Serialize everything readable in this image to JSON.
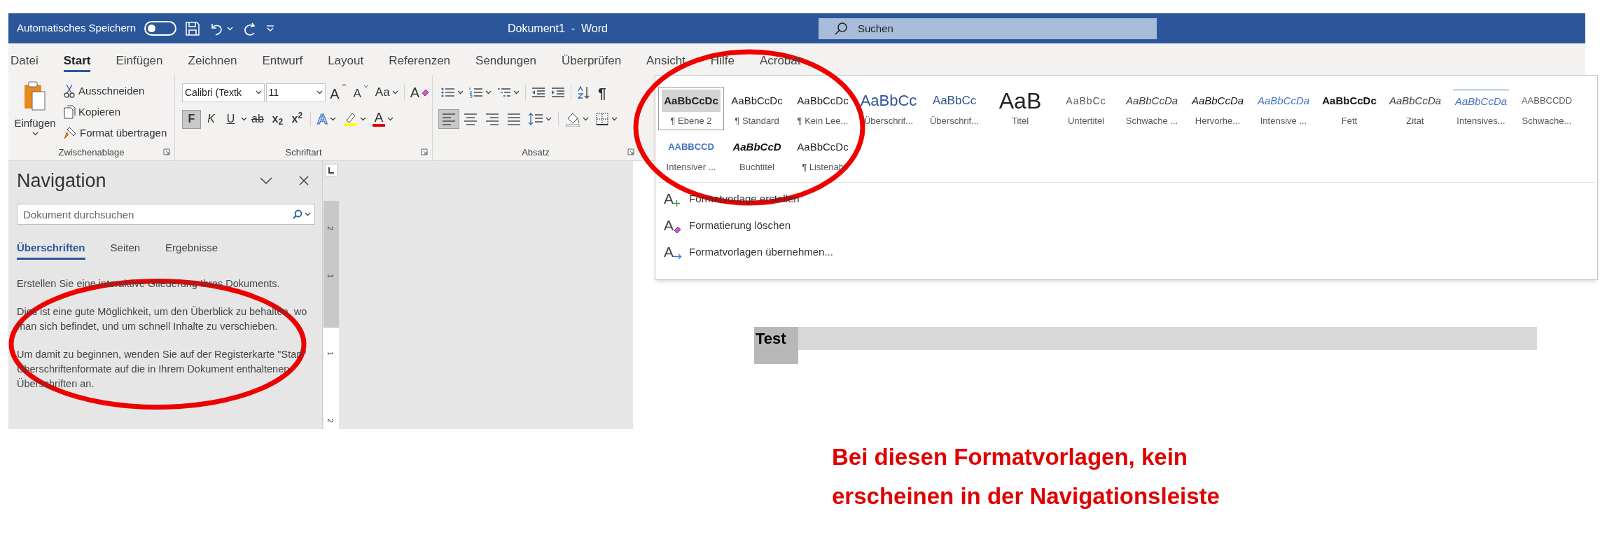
{
  "title_bar": {
    "autosave": {
      "label": "Automatisches Speichern",
      "on": false
    },
    "title": "Dokument1  -  Word",
    "search": {
      "placeholder": "Suchen"
    }
  },
  "tabs": [
    {
      "label": "Datei",
      "selected": false
    },
    {
      "label": "Start",
      "selected": true
    },
    {
      "label": "Einfügen",
      "selected": false
    },
    {
      "label": "Zeichnen",
      "selected": false
    },
    {
      "label": "Entwurf",
      "selected": false
    },
    {
      "label": "Layout",
      "selected": false
    },
    {
      "label": "Referenzen",
      "selected": false
    },
    {
      "label": "Sendungen",
      "selected": false
    },
    {
      "label": "Überprüfen",
      "selected": false
    },
    {
      "label": "Ansicht",
      "selected": false
    },
    {
      "label": "Hilfe",
      "selected": false
    },
    {
      "label": "Acrobat",
      "selected": false
    }
  ],
  "ribbon": {
    "clipboard": {
      "paste": "Einfügen",
      "items": [
        {
          "kind": "cut",
          "label": "Ausschneiden"
        },
        {
          "kind": "copy",
          "label": "Kopieren"
        },
        {
          "kind": "painter",
          "label": "Format übertragen"
        }
      ],
      "group_label": "Zwischenablage"
    },
    "font": {
      "font_name": "Calibri (Textk",
      "font_size": "11",
      "size_buttons": [
        {
          "kind": "grow",
          "label": "A"
        },
        {
          "kind": "shrink",
          "label": "A"
        },
        {
          "kind": "case",
          "label": "Aa"
        },
        {
          "kind": "clear",
          "label": "A"
        }
      ],
      "toggles": [
        {
          "kind": "bold",
          "label": "F",
          "on": true
        },
        {
          "kind": "italic",
          "label": "K",
          "on": false
        },
        {
          "kind": "underline",
          "label": "U",
          "on": false
        },
        {
          "kind": "strike",
          "label": "ab",
          "on": false
        },
        {
          "kind": "subscript",
          "label": "x$_{2}$",
          "on": false
        },
        {
          "kind": "superscript",
          "label": "x$^{2}$",
          "on": false
        }
      ],
      "color_buttons": [
        {
          "kind": "effects",
          "label": "A"
        },
        {
          "kind": "highlight"
        },
        {
          "kind": "color",
          "label": "A"
        }
      ],
      "group_label": "Schriftart"
    },
    "paragraph": {
      "alignment": [
        {
          "kind": "left",
          "selected": true
        },
        {
          "kind": "center",
          "selected": false
        },
        {
          "kind": "right",
          "selected": false
        },
        {
          "kind": "justify",
          "selected": false
        }
      ],
      "pilcrow": "¶",
      "group_label": "Absatz"
    }
  },
  "navigation": {
    "title": "Navigation",
    "search": {
      "placeholder": "Dokument durchsuchen"
    },
    "tabs": [
      {
        "label": "Überschriften",
        "selected": true
      },
      {
        "label": "Seiten",
        "selected": false
      },
      {
        "label": "Ergebnisse",
        "selected": false
      }
    ],
    "paragraphs": [
      "Erstellen Sie eine interaktive Gliederung Ihres Dokuments.",
      "Dies ist eine gute Möglichkeit, um den Überblick zu behalten, wo man sich befindet, und um schnell Inhalte zu verschieben.",
      "Um damit zu beginnen, wenden Sie auf der Registerkarte \"Start\" Überschriftenformate auf die in Ihrem Dokument enthaltenen Überschriften an."
    ]
  },
  "ruler": {
    "labels": [
      "2",
      "1",
      "1",
      "2"
    ]
  },
  "document": {
    "heading": "Test"
  },
  "styles_gallery": {
    "styles": [
      {
        "kind": "level2",
        "preview": "AaBbCcDc",
        "label": "¶ Ebene 2",
        "selected": true
      },
      {
        "kind": "normal",
        "preview": "AaBbCcDc",
        "label": "¶ Standard",
        "selected": false
      },
      {
        "kind": "normal",
        "preview": "AaBbCcDc",
        "label": "¶ Kein Lee...",
        "selected": false
      },
      {
        "kind": "heading1",
        "preview": "AaBbCc",
        "label": "Überschrif...",
        "selected": false
      },
      {
        "kind": "heading2",
        "preview": "AaBbCc",
        "label": "Überschrif...",
        "selected": false
      },
      {
        "kind": "title",
        "preview": "AaB",
        "label": "Titel",
        "selected": false
      },
      {
        "kind": "subtitle",
        "preview": "AaBbCc",
        "label": "Untertitel",
        "selected": false
      },
      {
        "kind": "subtle_emphasis",
        "preview": "AaBbCcDa",
        "label": "Schwache ...",
        "selected": false
      },
      {
        "kind": "emphasis",
        "preview": "AaBbCcDa",
        "label": "Hervorhe...",
        "selected": false
      },
      {
        "kind": "intense_emphasis",
        "preview": "AaBbCcDa",
        "label": "Intensive ...",
        "selected": false
      },
      {
        "kind": "strong",
        "preview": "AaBbCcDc",
        "label": "Fett",
        "selected": false
      },
      {
        "kind": "quote",
        "preview": "AaBbCcDa",
        "label": "Zitat",
        "selected": false
      },
      {
        "kind": "intense_quote",
        "preview": "AaBbCcDa",
        "label": "Intensives...",
        "selected": false
      },
      {
        "kind": "subtle_reference",
        "preview": "AABBCCDD",
        "label": "Schwache...",
        "selected": false
      },
      {
        "kind": "intense_reference",
        "preview": "AABBCCD",
        "label": "Intensiver ...",
        "selected": false
      },
      {
        "kind": "book_title",
        "preview": "AaBbCcD",
        "label": "Buchtitel",
        "selected": false
      },
      {
        "kind": "normal",
        "preview": "AaBbCcDc",
        "label": "¶ Listenab",
        "selected": false
      }
    ],
    "commands": [
      {
        "kind": "create",
        "glyph": "A",
        "label": "Formatvorlage erstellen"
      },
      {
        "kind": "clear",
        "glyph": "A",
        "label": "Formatierung löschen"
      },
      {
        "kind": "apply",
        "glyph": "A",
        "label": "Formatvorlagen übernehmen..."
      }
    ]
  },
  "annotation": {
    "lines": [
      "Bei diesen Formatvorlagen, kein",
      "erscheinen in der Navigationsleiste"
    ]
  }
}
